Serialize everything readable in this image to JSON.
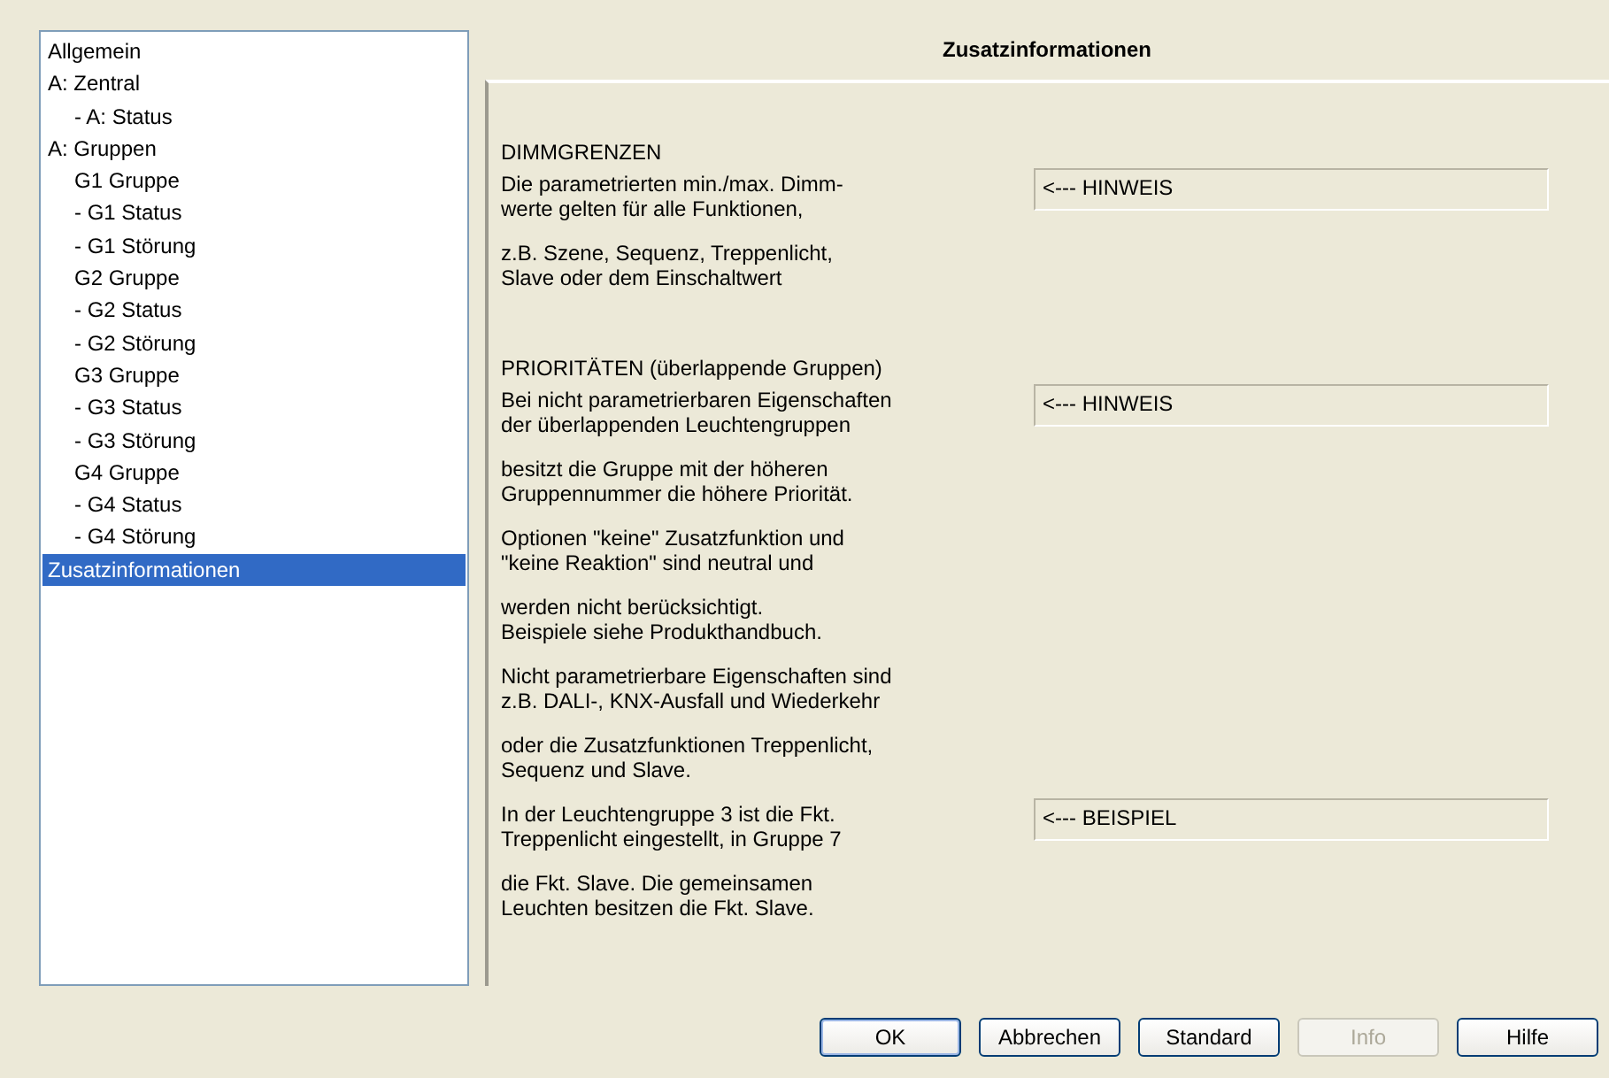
{
  "sidebar": {
    "items": [
      {
        "label": "Allgemein",
        "selected": false
      },
      {
        "label": "A: Zentral",
        "selected": false,
        "children": [
          {
            "label": "- A: Status",
            "selected": false
          }
        ]
      },
      {
        "label": "A: Gruppen",
        "selected": false,
        "children": [
          {
            "label": "G1 Gruppe",
            "selected": false
          },
          {
            "label": "- G1 Status",
            "selected": false
          },
          {
            "label": "- G1 Störung",
            "selected": false
          },
          {
            "label": "G2 Gruppe",
            "selected": false
          },
          {
            "label": "- G2 Status",
            "selected": false
          },
          {
            "label": "- G2 Störung",
            "selected": false
          },
          {
            "label": "G3 Gruppe",
            "selected": false
          },
          {
            "label": "- G3 Status",
            "selected": false
          },
          {
            "label": "- G3 Störung",
            "selected": false
          },
          {
            "label": "G4 Gruppe",
            "selected": false
          },
          {
            "label": "- G4 Status",
            "selected": false
          },
          {
            "label": "- G4 Störung",
            "selected": false
          }
        ]
      },
      {
        "label": "Zusatzinformationen",
        "selected": true
      }
    ]
  },
  "panel": {
    "title": "Zusatzinformationen",
    "rows": [
      {
        "kind": "heading",
        "text": "DIMMGRENZEN"
      },
      {
        "kind": "text",
        "lines": [
          "Die parametrierten min./max. Dimm-",
          "werte gelten für alle Funktionen,"
        ],
        "hint": "<--- HINWEIS"
      },
      {
        "kind": "text",
        "lines": [
          "z.B. Szene, Sequenz, Treppenlicht,",
          "Slave oder dem Einschaltwert"
        ]
      },
      {
        "kind": "heading",
        "text": "PRIORITÄTEN (überlappende Gruppen)"
      },
      {
        "kind": "text",
        "lines": [
          "Bei nicht parametrierbaren Eigenschaften",
          "der überlappenden Leuchtengruppen"
        ],
        "hint": "<--- HINWEIS"
      },
      {
        "kind": "text",
        "lines": [
          "besitzt die Gruppe mit der höheren",
          "Gruppennummer die höhere Priorität."
        ]
      },
      {
        "kind": "text",
        "lines": [
          "Optionen \"keine\" Zusatzfunktion und",
          "\"keine Reaktion\" sind neutral und"
        ]
      },
      {
        "kind": "text",
        "lines": [
          "werden nicht berücksichtigt.",
          "Beispiele siehe Produkthandbuch."
        ]
      },
      {
        "kind": "text",
        "lines": [
          "Nicht parametrierbare Eigenschaften sind",
          "z.B. DALI-, KNX-Ausfall und Wiederkehr"
        ]
      },
      {
        "kind": "text",
        "lines": [
          "oder die Zusatzfunktionen Treppenlicht,",
          "Sequenz und Slave."
        ]
      },
      {
        "kind": "text",
        "lines": [
          "In der Leuchtengruppe 3 ist die Fkt.",
          "Treppenlicht eingestellt, in Gruppe 7"
        ],
        "hint": "<--- BEISPIEL"
      },
      {
        "kind": "text",
        "lines": [
          "die Fkt. Slave. Die gemeinsamen",
          "Leuchten besitzen die Fkt. Slave."
        ]
      }
    ]
  },
  "buttons": [
    {
      "label": "OK",
      "disabled": false,
      "default": true
    },
    {
      "label": "Abbrechen",
      "disabled": false,
      "default": false
    },
    {
      "label": "Standard",
      "disabled": false,
      "default": false
    },
    {
      "label": "Info",
      "disabled": true,
      "default": false
    },
    {
      "label": "Hilfe",
      "disabled": false,
      "default": false
    }
  ]
}
